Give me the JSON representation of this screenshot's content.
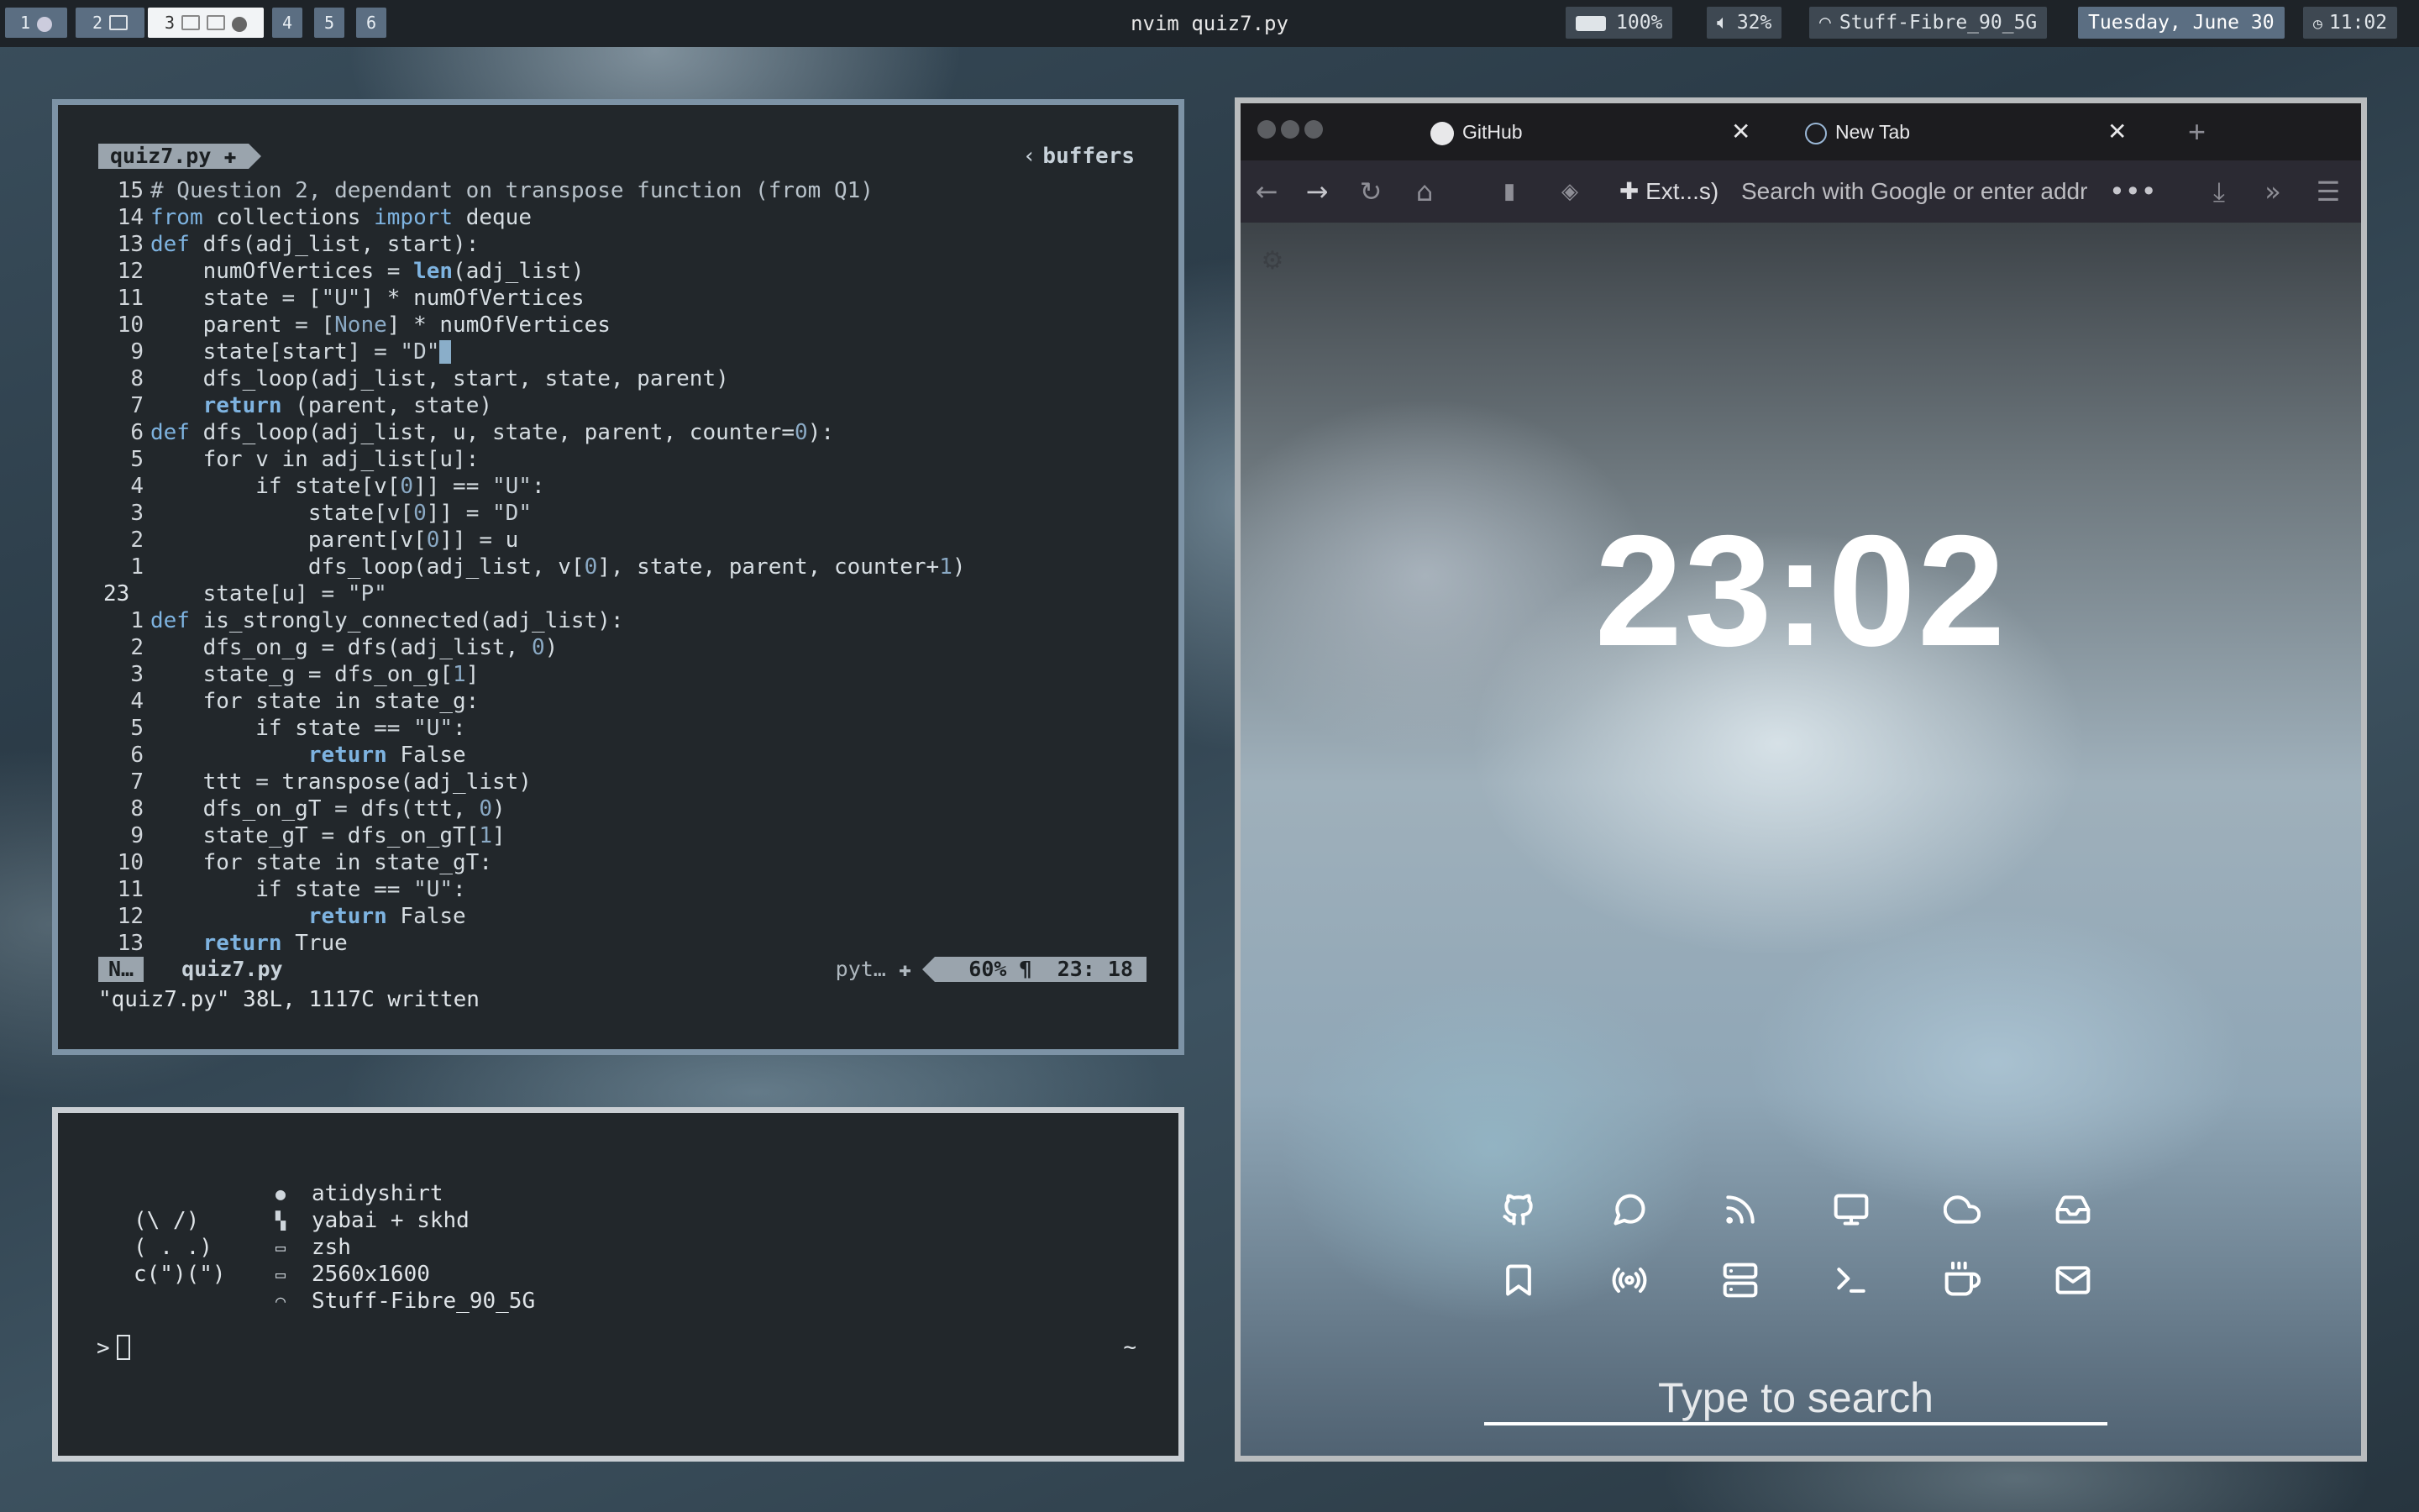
{
  "topbar": {
    "workspaces": [
      "1",
      "2",
      "3",
      "4",
      "5",
      "6"
    ],
    "active_workspace": "3",
    "title": "nvim quiz7.py",
    "battery": "100%",
    "volume": "32%",
    "wifi": "Stuff-Fibre_90_5G",
    "date": "Tuesday, June 30",
    "time": "11:02"
  },
  "nvim": {
    "tab_file": "quiz7.py",
    "buffers_label": "buffers",
    "lines": [
      {
        "n": "15",
        "t": "# Question 2, dependant on transpose function (from Q1)"
      },
      {
        "n": "14",
        "t": "from collections import deque"
      },
      {
        "n": "13",
        "t": "def dfs(adj_list, start):"
      },
      {
        "n": "12",
        "t": "    numOfVertices = len(adj_list)"
      },
      {
        "n": "11",
        "t": "    state = [\"U\"] * numOfVertices"
      },
      {
        "n": "10",
        "t": "    parent = [None] * numOfVertices"
      },
      {
        "n": "9",
        "t": "    state[start] = \"D\""
      },
      {
        "n": "8",
        "t": "    dfs_loop(adj_list, start, state, parent)"
      },
      {
        "n": "7",
        "t": "    return (parent, state)"
      },
      {
        "n": "6",
        "t": "def dfs_loop(adj_list, u, state, parent, counter=0):"
      },
      {
        "n": "5",
        "t": "    for v in adj_list[u]:"
      },
      {
        "n": "4",
        "t": "        if state[v[0]] == \"U\":"
      },
      {
        "n": "3",
        "t": "            state[v[0]] = \"D\""
      },
      {
        "n": "2",
        "t": "            parent[v[0]] = u"
      },
      {
        "n": "1",
        "t": "            dfs_loop(adj_list, v[0], state, parent, counter+1)"
      },
      {
        "n": "23",
        "t": "    state[u] = \"P\""
      },
      {
        "n": "1",
        "t": "def is_strongly_connected(adj_list):"
      },
      {
        "n": "2",
        "t": "    dfs_on_g = dfs(adj_list, 0)"
      },
      {
        "n": "3",
        "t": "    state_g = dfs_on_g[1]"
      },
      {
        "n": "4",
        "t": "    for state in state_g:"
      },
      {
        "n": "5",
        "t": "        if state == \"U\":"
      },
      {
        "n": "6",
        "t": "            return False"
      },
      {
        "n": "7",
        "t": "    ttt = transpose(adj_list)"
      },
      {
        "n": "8",
        "t": "    dfs_on_gT = dfs(ttt, 0)"
      },
      {
        "n": "9",
        "t": "    state_gT = dfs_on_gT[1]"
      },
      {
        "n": "10",
        "t": "    for state in state_gT:"
      },
      {
        "n": "11",
        "t": "        if state == \"U\":"
      },
      {
        "n": "12",
        "t": "            return False"
      },
      {
        "n": "13",
        "t": "    return True"
      }
    ],
    "status": {
      "mode": "N…",
      "file": "quiz7.py",
      "filetype": "pyt…",
      "percent": "60%",
      "pilcrow": "¶",
      "position": "23: 18"
    },
    "cmdline": "\"quiz7.py\" 38L, 1117C written"
  },
  "terminal": {
    "ascii_art": "(\\ /)\n( . .)\nc(\")(\")",
    "info": [
      {
        "icon": "apple-icon",
        "value": "atidyshirt"
      },
      {
        "icon": "window-manager-icon",
        "value": "yabai + skhd"
      },
      {
        "icon": "terminal-icon",
        "value": "zsh"
      },
      {
        "icon": "monitor-icon",
        "value": "2560x1600"
      },
      {
        "icon": "wifi-icon",
        "value": "Stuff-Fibre_90_5G"
      }
    ],
    "prompt": ">",
    "cwd": "~"
  },
  "browser": {
    "tabs": [
      {
        "label": "GitHub",
        "icon": "github-icon"
      },
      {
        "label": "New Tab",
        "icon": "firefox-icon"
      }
    ],
    "extensions_label": "Ext...s)",
    "url_placeholder": "Search with Google or enter addr",
    "newtab": {
      "clock": "23:02",
      "search_placeholder": "Type to search",
      "quicklinks_row1": [
        "github-icon",
        "chat-icon",
        "rss-icon",
        "monitor-icon",
        "cloud-icon",
        "inbox-icon"
      ],
      "quicklinks_row2": [
        "bookmark-icon",
        "broadcast-icon",
        "server-icon",
        "terminal-icon",
        "coffee-icon",
        "mail-icon"
      ]
    }
  }
}
